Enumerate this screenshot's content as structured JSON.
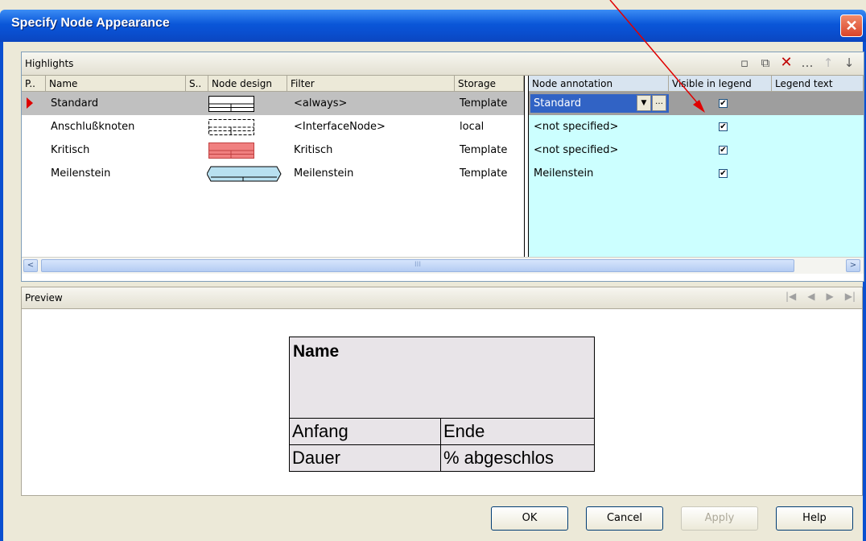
{
  "window": {
    "title": "Specify Node Appearance",
    "close_glyph": "✕"
  },
  "highlights": {
    "label": "Highlights",
    "toolbar": [
      "new-icon",
      "copy-icon",
      "delete-icon",
      "ellipsis-icon",
      "up-arrow-icon",
      "down-arrow-icon"
    ],
    "toolbar_glyphs": [
      "▫",
      "⧉",
      "✕",
      "…",
      "↑",
      "↓"
    ],
    "columns_left": [
      "P..",
      "Name",
      "S..",
      "Node design",
      "Filter",
      "Storage"
    ],
    "columns_right": [
      "Node annotation",
      "Visible in legend",
      "Legend text"
    ],
    "rows": [
      {
        "name": "Standard",
        "filter": "<always>",
        "storage": "Template",
        "annotation": "Standard",
        "visible": true,
        "selected": true
      },
      {
        "name": "Anschlußknoten",
        "filter": "<InterfaceNode>",
        "storage": "local",
        "annotation": "<not specified>",
        "visible": true,
        "selected": false
      },
      {
        "name": "Kritisch",
        "filter": "Kritisch",
        "storage": "Template",
        "annotation": "<not specified>",
        "visible": true,
        "selected": false
      },
      {
        "name": "Meilenstein",
        "filter": "Meilenstein",
        "storage": "Template",
        "annotation": "Meilenstein",
        "visible": true,
        "selected": false
      }
    ],
    "checkmark": "✔",
    "dropdown_glyph": "▼",
    "ellipsis_glyph": "…",
    "scroll_left": "<",
    "scroll_right": ">",
    "scroll_grip": "III"
  },
  "preview": {
    "label": "Preview",
    "nav_glyphs": [
      "|◀",
      "◀",
      "▶",
      "▶|"
    ],
    "node": {
      "name": "Name",
      "cells": [
        "Anfang",
        "Ende",
        "Dauer",
        "% abgeschlos"
      ]
    }
  },
  "buttons": {
    "ok": "OK",
    "cancel": "Cancel",
    "apply": "Apply",
    "help": "Help"
  },
  "colors": {
    "title_blue": "#0a56d8",
    "annotation_bg": "#ccffff",
    "selected_row": "#c0c0c0",
    "critical_red": "#f08080",
    "milestone_blue": "#b8e0f0"
  }
}
